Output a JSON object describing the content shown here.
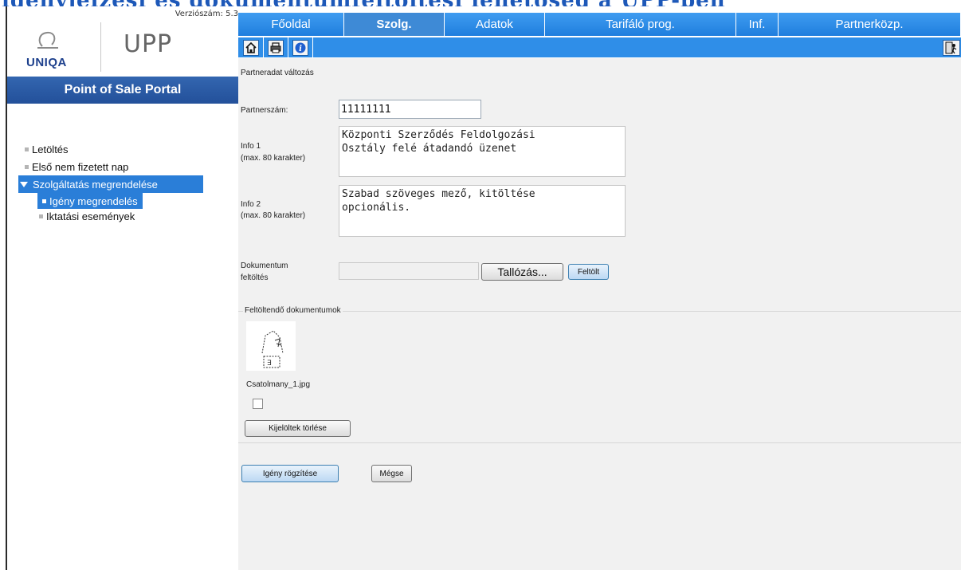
{
  "top_heading_clipped": "igényjelzési és dokumentumfeltöltési lehetőség a UPP-ben",
  "sidebar": {
    "version_label": "Verziószám: 5.3",
    "logo_word": "UNIQA",
    "logo_upp": "UPP",
    "portal_title": "Point of Sale Portal",
    "items": [
      {
        "label": "Letöltés"
      },
      {
        "label": "Első nem fizetett nap"
      },
      {
        "label": "Szolgáltatás megrendelése",
        "expanded": true
      },
      {
        "label": "Igény megrendelés",
        "active": true
      },
      {
        "label": "Iktatási események"
      }
    ]
  },
  "tabs": [
    {
      "label": "Főoldal"
    },
    {
      "label": "Szolg.",
      "active": true
    },
    {
      "label": "Adatok"
    },
    {
      "label": "Tarifáló prog."
    },
    {
      "label": "Inf."
    },
    {
      "label": "Partnerközp."
    }
  ],
  "toolbar": {
    "icons": [
      "home-icon",
      "print-icon",
      "info-icon",
      "logout-icon"
    ]
  },
  "form": {
    "title": "Partneradat változás",
    "partner_label": "Partnerszám:",
    "partner_value": "11111111",
    "info1_label": "Info 1",
    "info1_hint": "(max. 80 karakter)",
    "info1_value": "Központi Szerződés Feldolgozási\nOsztály felé átadandó üzenet",
    "info2_label": "Info 2",
    "info2_hint": "(max. 80 karakter)",
    "info2_value": "Szabad szöveges mező, kitöltése\nopcionális.",
    "doc_label_line1": "Dokumentum",
    "doc_label_line2": "feltöltés",
    "browse_label": "Tallózás...",
    "upload_label": "Feltölt",
    "uploaded_legend": "Feltöltendő dokumentumok",
    "file_name": "Csatolmany_1.jpg",
    "file_checked": false,
    "delete_selected_label": "Kijelöltek törlése",
    "submit_label": "Igény rögzítése",
    "cancel_label": "Mégse"
  },
  "colors": {
    "nav_blue": "#2f8ee8",
    "portal_blue": "#23509a",
    "active_item": "#2a7ed8"
  }
}
